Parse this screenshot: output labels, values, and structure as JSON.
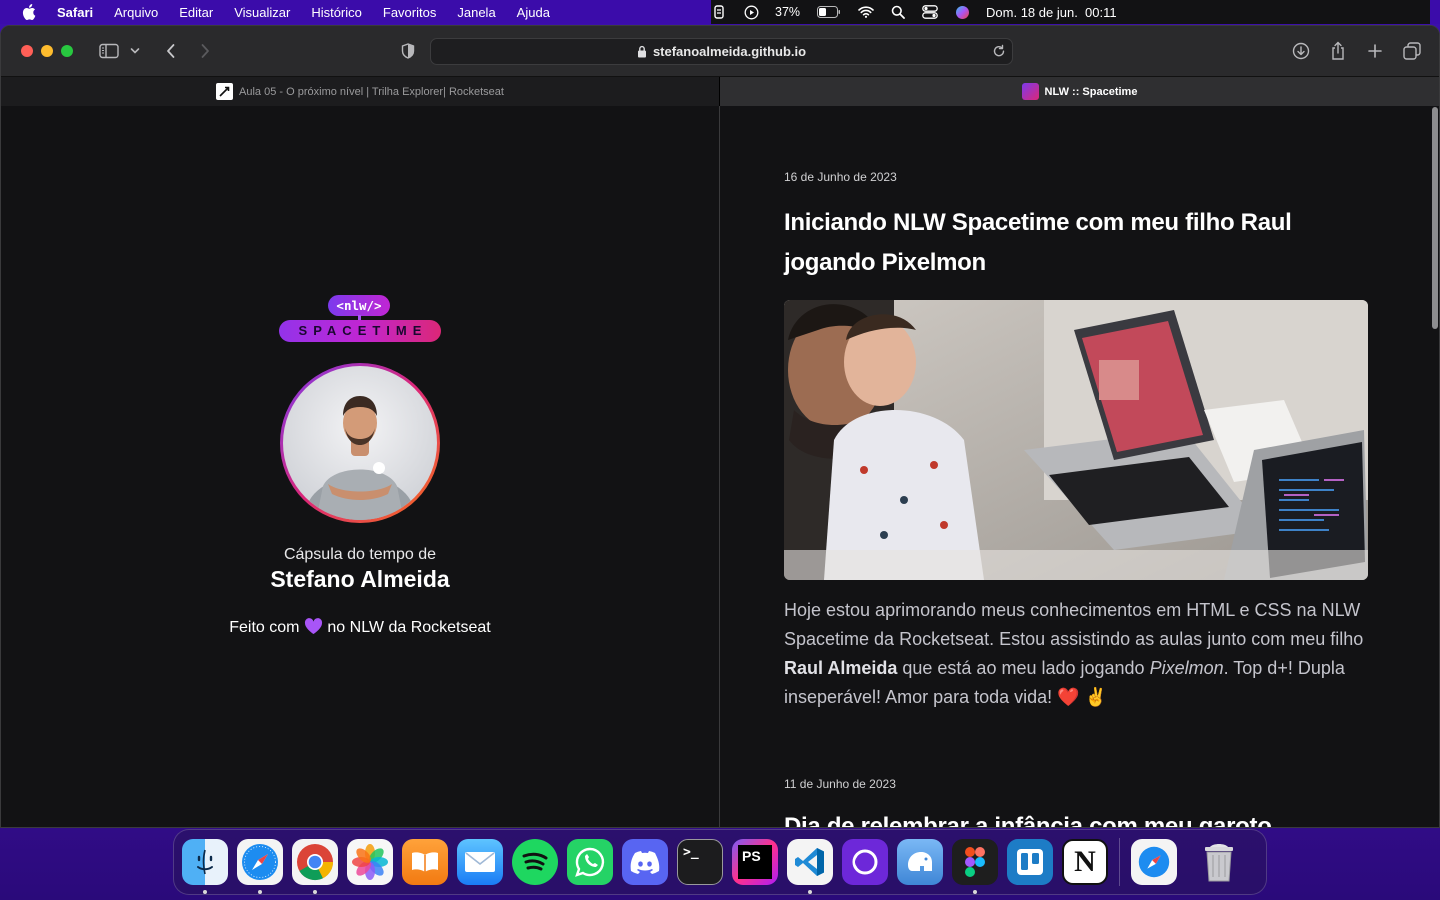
{
  "menubar": {
    "app_name": "Safari",
    "items": [
      "Arquivo",
      "Editar",
      "Visualizar",
      "Histórico",
      "Favoritos",
      "Janela",
      "Ajuda"
    ],
    "battery": "37%",
    "datetime": "Dom. 18 de jun.  00:11"
  },
  "browser": {
    "url": "stefanoalmeida.github.io",
    "tabs": [
      {
        "title": "Aula 05 - O próximo nível | Trilha Explorer| Rocketseat",
        "active": false
      },
      {
        "title": "NLW :: Spacetime",
        "active": true
      }
    ]
  },
  "page": {
    "logo_top": "<nlw/>",
    "logo_bottom": "SPACETIME",
    "capsule_line1": "Cápsula do tempo de",
    "capsule_name": "Stefano Almeida",
    "made_with_prefix": "Feito com",
    "made_with_suffix": "no NLW da Rocketseat",
    "posts": [
      {
        "date": "16 de Junho de 2023",
        "title": "Iniciando NLW Spacetime com meu filho Raul jogando Pixelmon",
        "text_1": "Hoje estou aprimorando meus conhecimentos em HTML e CSS na NLW Spacetime da Rocketseat. Estou assistindo as aulas junto com meu filho ",
        "text_bold": "Raul Almeida",
        "text_2": " que está ao meu lado jogando ",
        "text_italic": "Pixelmon",
        "text_3": ". Top d+! Dupla inseperável! Amor para toda vida! ❤️ ✌️"
      },
      {
        "date": "11 de Junho de 2023",
        "title": "Dia de relembrar a infância com meu garoto"
      }
    ]
  },
  "dock": {
    "apps": [
      "finder-icon",
      "safari-icon",
      "chrome-icon",
      "photos-icon",
      "books-icon",
      "mail-icon",
      "spotify-icon",
      "whatsapp-icon",
      "discord-icon",
      "terminal-icon",
      "phpstorm-icon",
      "vscode-icon",
      "arc-icon",
      "tableplus-icon",
      "figma-icon",
      "trello-icon",
      "notion-icon",
      "downloads-safari-icon",
      "trash-icon"
    ],
    "labels": {
      "phpstorm": "PS",
      "notion": "N",
      "terminal": ">_"
    }
  },
  "colors": {
    "accent_purple": "#8257e5",
    "page_bg": "#121214"
  }
}
